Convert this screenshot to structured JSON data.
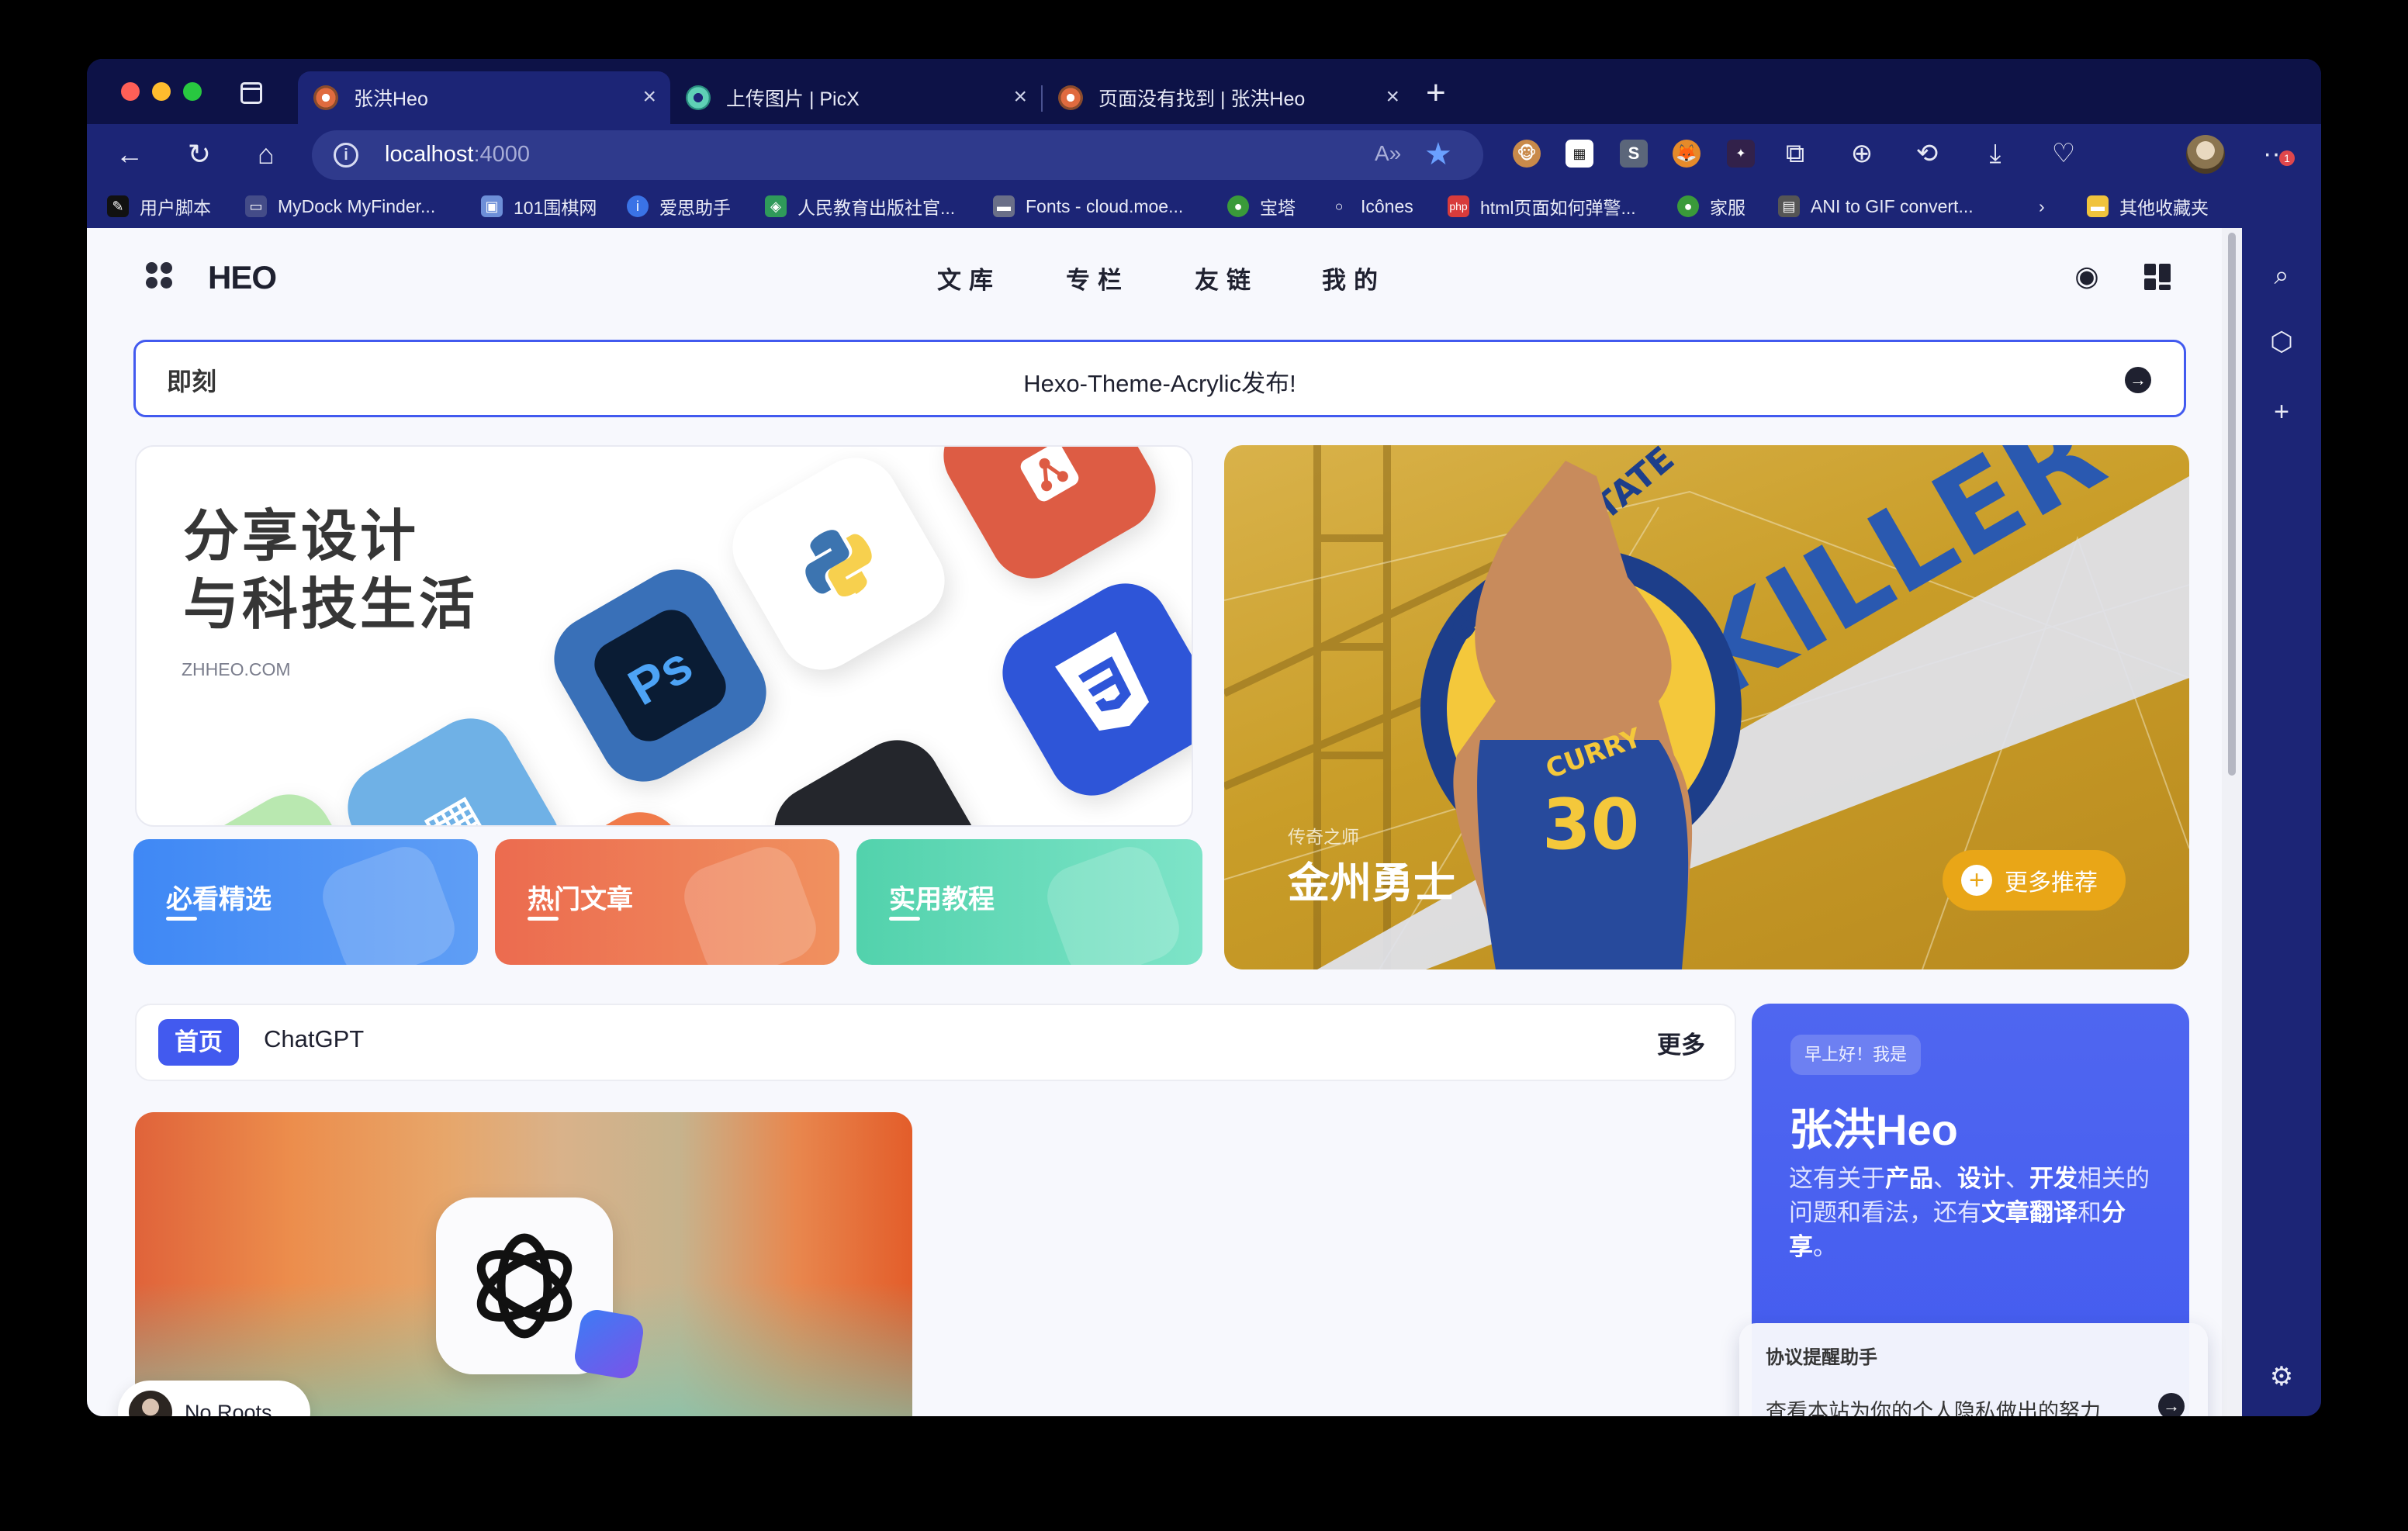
{
  "browser": {
    "tabs": [
      {
        "title": "张洪Heo",
        "active": true
      },
      {
        "title": "上传图片 | PicX",
        "active": false
      },
      {
        "title": "页面没有找到 | 张洪Heo",
        "active": false
      }
    ],
    "url_host": "localhost",
    "url_port": ":4000",
    "new_tab": "+",
    "notification_count": "1"
  },
  "bookmarks": [
    "用户脚本",
    "MyDock MyFinder...",
    "101围棋网",
    "爱思助手",
    "人民教育出版社官...",
    "Fonts - cloud.moe...",
    "宝塔",
    "Icônes",
    "html页面如何弹警...",
    "家服",
    "ANI to GIF convert...",
    "其他收藏夹"
  ],
  "site": {
    "logo": "HEO",
    "menu": [
      "文库",
      "专栏",
      "友链",
      "我的"
    ],
    "notice": {
      "label": "即刻",
      "text": "Hexo-Theme-Acrylic发布!"
    },
    "hero": {
      "title_line1": "分享设计",
      "title_line2": "与科技生活",
      "subtitle": "ZHHEO.COM"
    },
    "categories": [
      {
        "label": "必看精选",
        "color": "#4d8bf3"
      },
      {
        "label": "热门文章",
        "color": "#ef7c54"
      },
      {
        "label": "实用教程",
        "color": "#5ed8b8"
      }
    ],
    "featured": {
      "subtitle": "传奇之师",
      "title": "金州勇士",
      "more_label": "更多推荐",
      "art_text_1": "GOLDEN STATE",
      "art_text_2": "KILLER",
      "art_number": "30",
      "art_name": "CURRY"
    },
    "post_tabs": {
      "active": "首页",
      "items": [
        "ChatGPT"
      ],
      "more": "更多"
    },
    "player": {
      "label": "No Roots"
    },
    "author": {
      "greeting": "早上好！我是",
      "name": "张洪Heo",
      "desc_1": "这有关于",
      "desc_b1": "产品",
      "desc_2": "、",
      "desc_b2": "设计",
      "desc_3": "、",
      "desc_b3": "开发",
      "desc_4": "相关的问题和看法，还有",
      "desc_b4": "文章翻译",
      "desc_5": "和",
      "desc_b5": "分享",
      "desc_6": "。"
    },
    "popup": {
      "title": "协议提醒助手",
      "text": "查看本站为你的个人隐私做出的努力"
    }
  }
}
